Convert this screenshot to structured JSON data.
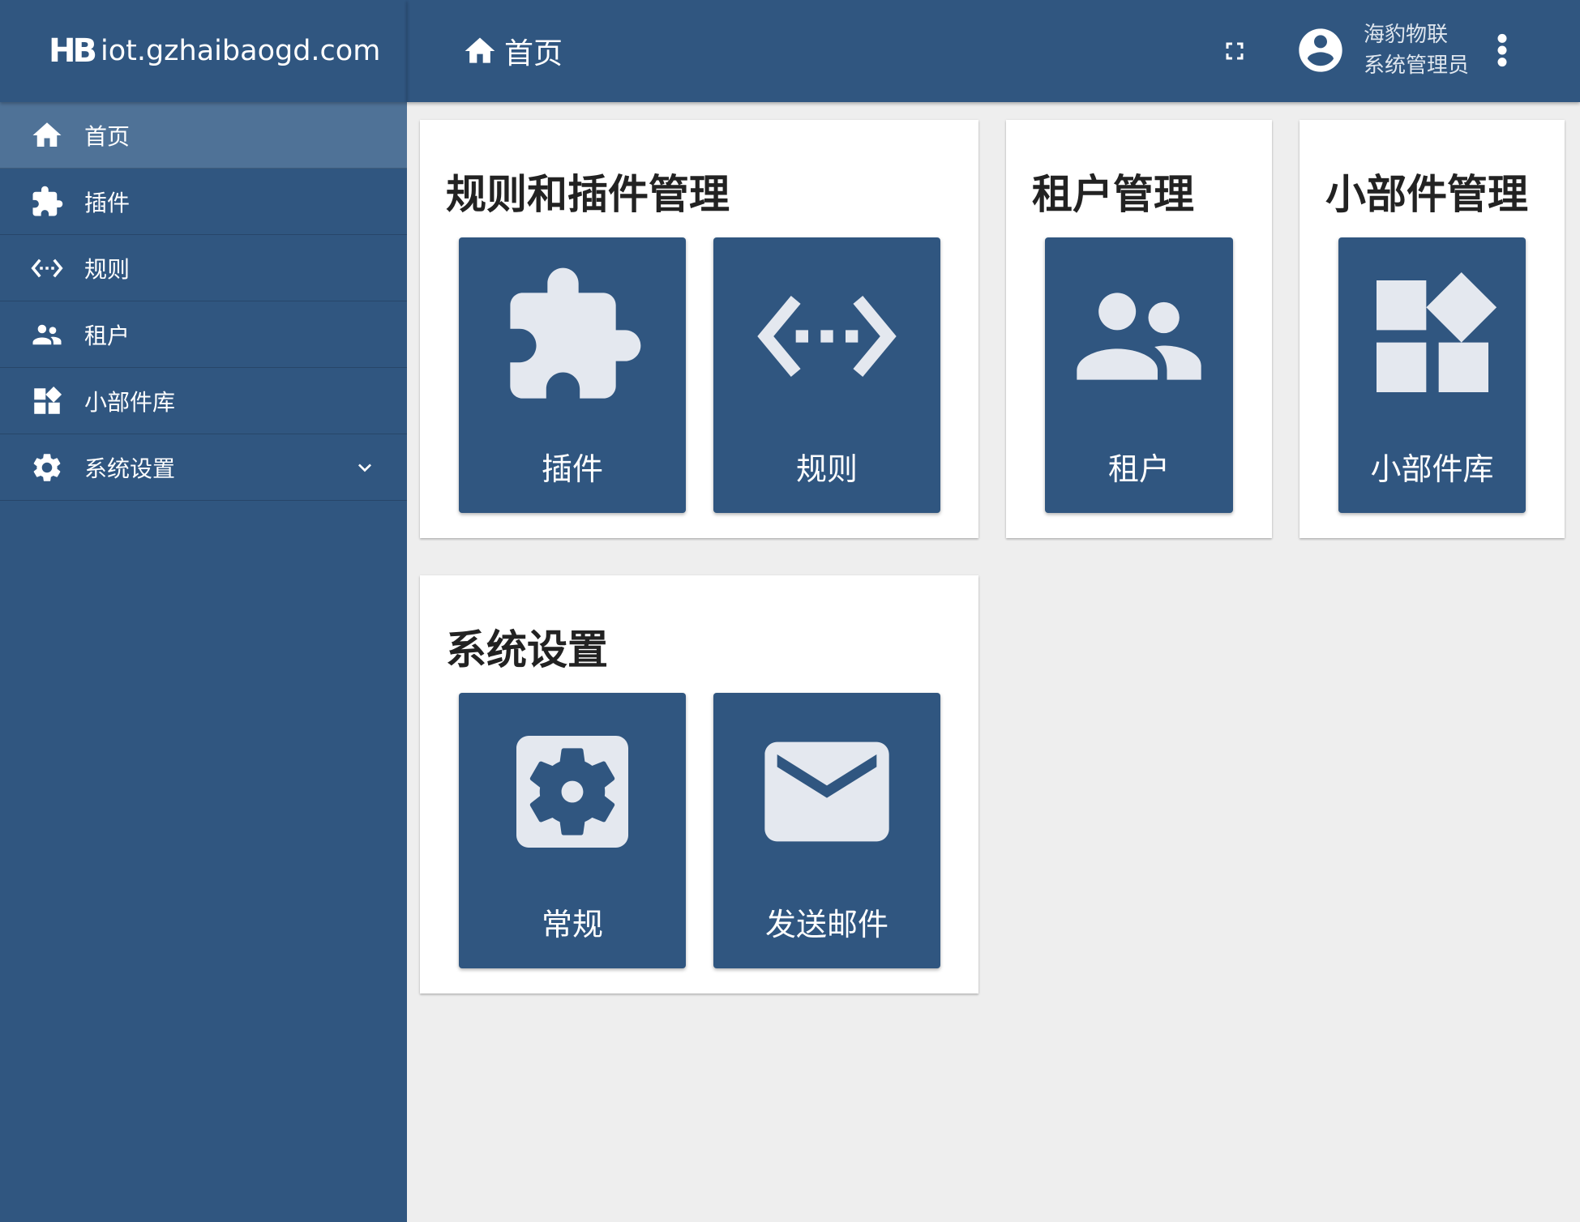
{
  "brand": {
    "logo_mark": "HB",
    "domain": "iot.gzhaibaogd.com"
  },
  "sidebar": {
    "items": [
      {
        "label": "首页",
        "icon": "home-icon",
        "active": true
      },
      {
        "label": "插件",
        "icon": "puzzle-icon"
      },
      {
        "label": "规则",
        "icon": "rule-chain-icon"
      },
      {
        "label": "租户",
        "icon": "people-icon"
      },
      {
        "label": "小部件库",
        "icon": "widgets-icon"
      },
      {
        "label": "系统设置",
        "icon": "gear-icon",
        "expandable": true
      }
    ]
  },
  "header": {
    "breadcrumb": "首页",
    "user_name": "海豹物联",
    "user_role": "系统管理员"
  },
  "cards": [
    {
      "title": "规则和插件管理",
      "tiles": [
        {
          "label": "插件",
          "icon": "puzzle-icon"
        },
        {
          "label": "规则",
          "icon": "rule-chain-icon"
        }
      ]
    },
    {
      "title": "租户管理",
      "tiles": [
        {
          "label": "租户",
          "icon": "people-icon"
        }
      ]
    },
    {
      "title": "小部件管理",
      "tiles": [
        {
          "label": "小部件库",
          "icon": "widgets-icon"
        }
      ]
    },
    {
      "title": "系统设置",
      "tiles": [
        {
          "label": "常规",
          "icon": "settings-applications-icon"
        },
        {
          "label": "发送邮件",
          "icon": "mail-icon"
        }
      ]
    }
  ],
  "colors": {
    "primary": "#305680",
    "active_nav": "#4f7297",
    "background": "#eeeeee",
    "tile_icon": "#e4e8ef"
  }
}
